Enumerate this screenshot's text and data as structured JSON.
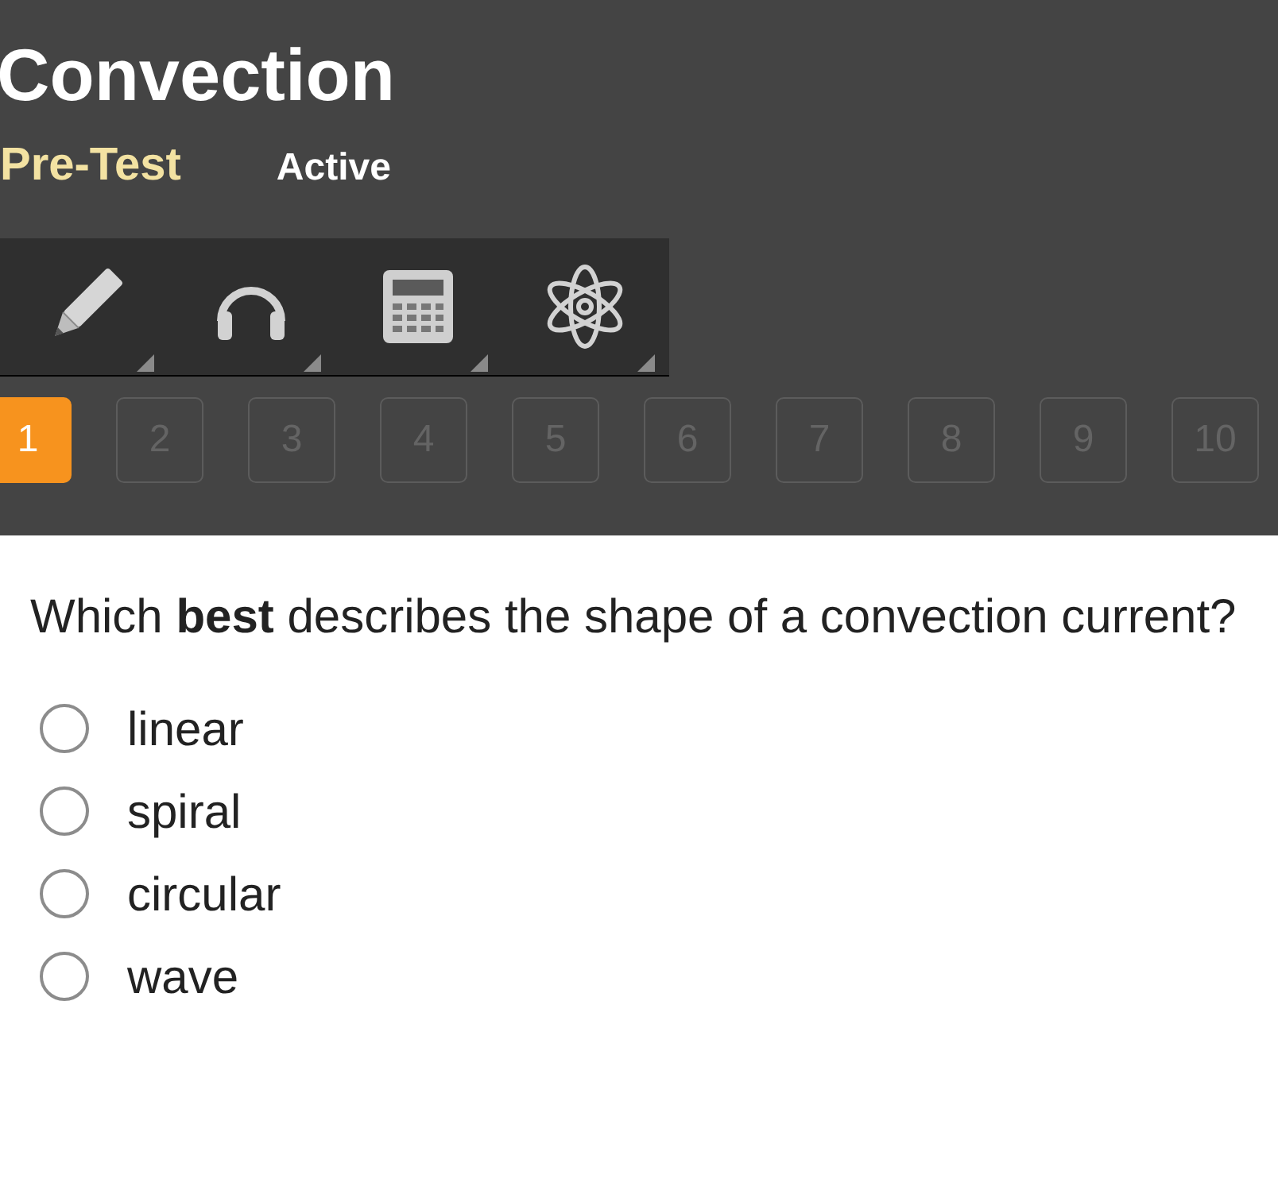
{
  "header": {
    "title": "Convection",
    "subtitle": "Pre-Test",
    "status": "Active"
  },
  "questions": [
    {
      "label": "1",
      "selected": true
    },
    {
      "label": "2",
      "selected": false
    },
    {
      "label": "3",
      "selected": false
    },
    {
      "label": "4",
      "selected": false
    },
    {
      "label": "5",
      "selected": false
    },
    {
      "label": "6",
      "selected": false
    },
    {
      "label": "7",
      "selected": false
    },
    {
      "label": "8",
      "selected": false
    },
    {
      "label": "9",
      "selected": false
    },
    {
      "label": "10",
      "selected": false
    }
  ],
  "question": {
    "text": "Which **best** describes the shape of a convection current?",
    "options": [
      {
        "label": "linear",
        "selected": false
      },
      {
        "label": "spiral",
        "selected": false
      },
      {
        "label": "circular",
        "selected": false
      },
      {
        "label": "wave",
        "selected": false
      }
    ]
  }
}
